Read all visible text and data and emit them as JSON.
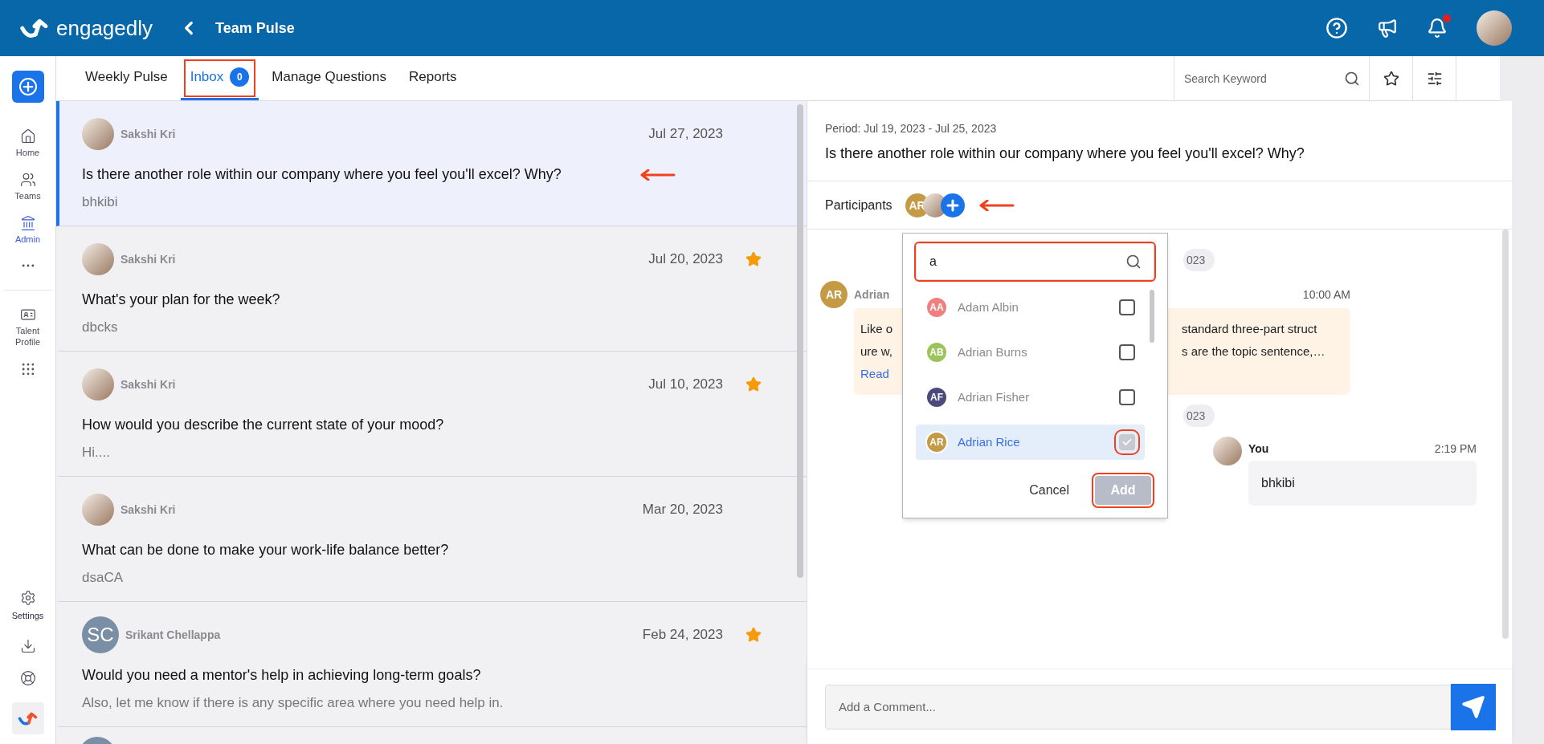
{
  "header": {
    "brand": "engagedly",
    "title": "Team Pulse",
    "notification_dot": true
  },
  "sidebar": {
    "items": [
      {
        "kind": "home",
        "label": "Home",
        "selected": false
      },
      {
        "kind": "teams",
        "label": "Teams",
        "selected": false
      },
      {
        "kind": "admin",
        "label": "Admin",
        "selected": true
      },
      {
        "kind": "more",
        "selected": false
      },
      {
        "kind": "profile",
        "label": "Talent Profile",
        "selected": false
      },
      {
        "kind": "apps",
        "selected": false
      }
    ],
    "bottom": [
      {
        "kind": "settings",
        "label": "Settings"
      },
      {
        "kind": "download"
      },
      {
        "kind": "help"
      }
    ]
  },
  "tabs": [
    {
      "label": "Weekly Pulse",
      "selected": false
    },
    {
      "label": "Inbox",
      "badge": "0",
      "selected": true
    },
    {
      "label": "Manage Questions",
      "selected": false
    },
    {
      "label": "Reports",
      "selected": false
    }
  ],
  "search": {
    "placeholder": "Search Keyword"
  },
  "inbox": [
    {
      "author": "Sakshi Kri",
      "kind": "photo",
      "date": "Jul 27, 2023",
      "question": "Is there another role within our company where you feel you'll excel? Why?",
      "answer": "bhkibi",
      "selected": true,
      "starred": false
    },
    {
      "author": "Sakshi Kri",
      "kind": "photo",
      "date": "Jul 20, 2023",
      "question": "What's your plan for the week?",
      "answer": "dbcks",
      "selected": false,
      "starred": true
    },
    {
      "author": "Sakshi Kri",
      "kind": "photo",
      "date": "Jul 10, 2023",
      "question": "How would you describe the current state of your mood?",
      "answer": "Hi....",
      "selected": false,
      "starred": true
    },
    {
      "author": "Sakshi Kri",
      "kind": "photo",
      "date": "Mar 20, 2023",
      "question": "What can be done to make your work-life balance better?",
      "answer": "dsaCA",
      "selected": false,
      "starred": false
    },
    {
      "author": "Srikant Chellappa",
      "kind": "initials",
      "initials": "SC",
      "date": "Feb 24, 2023",
      "question": "Would you need a mentor's help in achieving long-term goals?",
      "answer": "Also, let me know if there is any specific area where you need help in.",
      "selected": false,
      "starred": true
    }
  ],
  "detail": {
    "period": "Period: Jul 19, 2023 - Jul 25, 2023",
    "question": "Is there another role within our company where you feel you'll excel? Why?",
    "participants_label": "Participants",
    "participants": [
      {
        "kind": "initials",
        "initials": "AR",
        "color": "#c49a45"
      },
      {
        "kind": "photo"
      }
    ],
    "chat": [
      {
        "kind": "date",
        "text": "023"
      },
      {
        "kind": "other",
        "initials": "AR",
        "color": "#c49a45",
        "author": "Adrian",
        "time": "10:00 AM",
        "left_lines": [
          "Like o",
          "ure w,"
        ],
        "link": "Read",
        "right_lines": [
          "standard three-part struct",
          "s are the topic sentence,…"
        ]
      },
      {
        "kind": "date",
        "text": "023"
      },
      {
        "kind": "self",
        "author": "You",
        "time": "2:19 PM",
        "text": "bhkibi"
      }
    ],
    "comment": {
      "placeholder": "Add a Comment..."
    }
  },
  "picker": {
    "search_value": "a",
    "people": [
      {
        "initials": "AA",
        "color": "#f08080",
        "name": "Adam Albin",
        "checked": false,
        "selected": false
      },
      {
        "initials": "AB",
        "color": "#9cc45a",
        "name": "Adrian Burns",
        "checked": false,
        "selected": false
      },
      {
        "initials": "AF",
        "color": "#4b4a7d",
        "name": "Adrian Fisher",
        "checked": false,
        "selected": false
      },
      {
        "initials": "AR",
        "color": "#c49a45",
        "name": "Adrian Rice",
        "checked": true,
        "selected": true
      }
    ],
    "cancel": "Cancel",
    "add": "Add",
    "add_disabled": true
  }
}
